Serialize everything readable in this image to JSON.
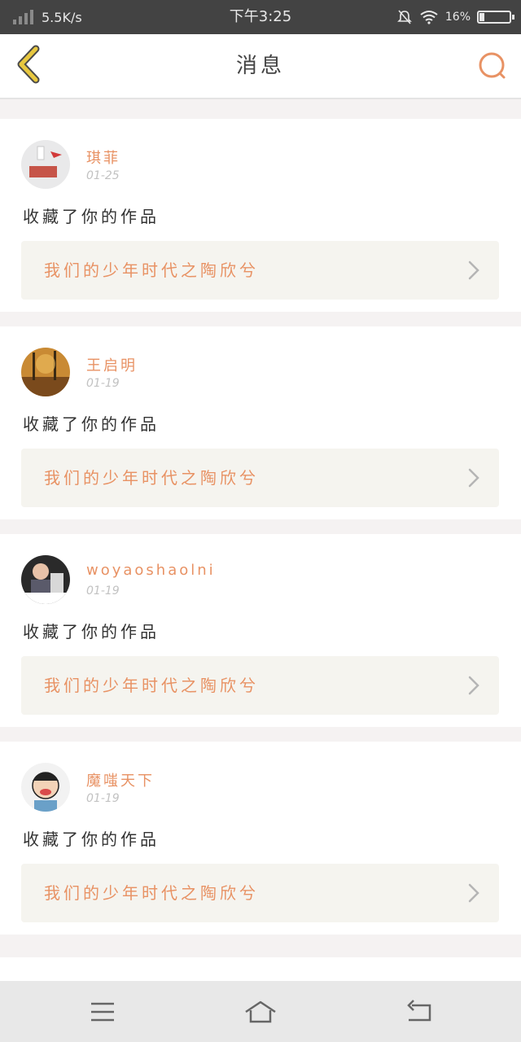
{
  "status_bar": {
    "net_speed": "5.5K/s",
    "time": "下午3:25",
    "battery_percent_label": "16%",
    "battery_level": 0.16
  },
  "header": {
    "title": "消息",
    "back_icon": "chevron-left-icon",
    "search_icon": "search-icon"
  },
  "colors": {
    "accent": "#e89264",
    "back_icon": "#e8c840"
  },
  "messages": [
    {
      "user": "琪菲",
      "date": "01-25",
      "action": "收藏了你的作品",
      "work_title": "我们的少年时代之陶欣兮"
    },
    {
      "user": "王启明",
      "date": "01-19",
      "action": "收藏了你的作品",
      "work_title": "我们的少年时代之陶欣兮"
    },
    {
      "user": "woyaoshaolni",
      "date": "01-19",
      "action": "收藏了你的作品",
      "work_title": "我们的少年时代之陶欣兮"
    },
    {
      "user": "魔嗤天下",
      "date": "01-19",
      "action": "收藏了你的作品",
      "work_title": "我们的少年时代之陶欣兮"
    }
  ],
  "nav_bar": {
    "menu_icon": "menu-icon",
    "home_icon": "home-icon",
    "back_icon": "back-icon"
  }
}
